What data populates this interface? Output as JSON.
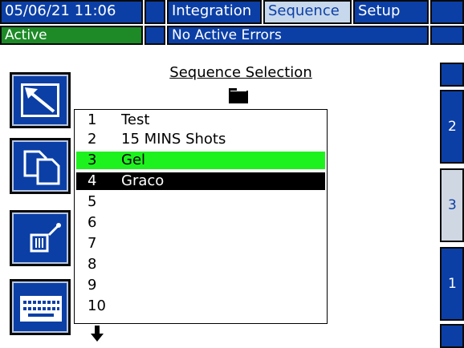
{
  "header": {
    "datetime": "05/06/21 11:06",
    "tabs": [
      {
        "label": "Integration"
      },
      {
        "label": "Sequence"
      },
      {
        "label": "Setup"
      }
    ],
    "active_tab": "Sequence",
    "status": "Active",
    "errors": "No Active Errors"
  },
  "main": {
    "title": "Sequence Selection",
    "rows": [
      {
        "num": "1",
        "name": "Test"
      },
      {
        "num": "2",
        "name": "15 MINS Shots"
      },
      {
        "num": "3",
        "name": "Gel"
      },
      {
        "num": "4",
        "name": "Graco"
      },
      {
        "num": "5",
        "name": ""
      },
      {
        "num": "6",
        "name": ""
      },
      {
        "num": "7",
        "name": ""
      },
      {
        "num": "8",
        "name": ""
      },
      {
        "num": "9",
        "name": ""
      },
      {
        "num": "10",
        "name": ""
      }
    ],
    "highlight": {
      "green_row": "3",
      "black_row": "4"
    }
  },
  "side_tabs": [
    {
      "label": "2"
    },
    {
      "label": "3"
    },
    {
      "label": "1"
    }
  ],
  "icons": {
    "left_buttons": [
      "exit-arrow-icon",
      "copy-icon",
      "erase-icon",
      "keyboard-icon"
    ],
    "folder": "folder-icon",
    "scroll": "down-arrow-icon"
  },
  "colors": {
    "accent_blue": "#0b3fa6",
    "status_green": "#1d8a27",
    "selected_row_green": "#1ef21e",
    "selected_row_black": "#000000"
  }
}
